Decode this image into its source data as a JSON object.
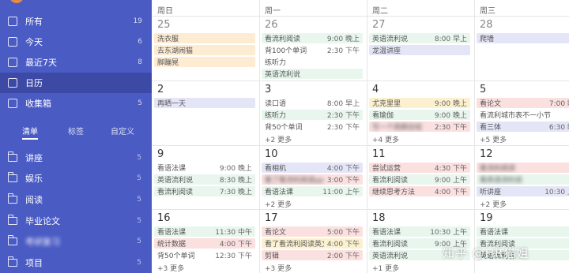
{
  "sidebar": {
    "items": [
      {
        "label": "所有",
        "count": "19"
      },
      {
        "label": "今天",
        "count": "6"
      },
      {
        "label": "最近7天",
        "count": "8"
      },
      {
        "label": "日历",
        "count": ""
      },
      {
        "label": "收集箱",
        "count": "5"
      }
    ],
    "tabs": [
      "清单",
      "标签",
      "自定义"
    ],
    "lists": [
      {
        "label": "讲座",
        "count": "5"
      },
      {
        "label": "娱乐",
        "count": "5"
      },
      {
        "label": "阅读",
        "count": "5"
      },
      {
        "label": "毕业论文",
        "count": "5"
      },
      {
        "label": "考研复习",
        "count": "5"
      },
      {
        "label": "项目",
        "count": "5"
      }
    ]
  },
  "calendar": {
    "headers": [
      "周日",
      "周一",
      "周二",
      "周三"
    ],
    "weeks": [
      {
        "days": [
          {
            "num": "25",
            "events": [
              {
                "title": "洗衣服",
                "time": "",
                "color": "orange"
              },
              {
                "title": "去东湖闹猫",
                "time": "",
                "color": "orange"
              },
              {
                "title": "脚蹦晃",
                "time": "",
                "color": "orange"
              }
            ],
            "more": ""
          },
          {
            "num": "26",
            "events": [
              {
                "title": "看流利阅读",
                "time": "9:00 晚上",
                "color": "green"
              },
              {
                "title": "背100个单词",
                "time": "2:30 下午",
                "color": "white"
              },
              {
                "title": "练听力",
                "time": "",
                "color": "white"
              },
              {
                "title": "英语流利说",
                "time": "",
                "color": "green"
              }
            ],
            "more": ""
          },
          {
            "num": "27",
            "events": [
              {
                "title": "英语流利说",
                "time": "8:00 早上",
                "color": "green"
              },
              {
                "title": "龙温讲座",
                "time": "",
                "color": "purple"
              }
            ],
            "more": ""
          },
          {
            "num": "28",
            "events": [
              {
                "title": "爬墙",
                "time": "",
                "color": "purple"
              }
            ],
            "more": ""
          }
        ]
      },
      {
        "days": [
          {
            "num": "2",
            "events": [
              {
                "title": "再晒一天",
                "time": "",
                "color": "purple"
              }
            ],
            "more": ""
          },
          {
            "num": "3",
            "events": [
              {
                "title": "读口语",
                "time": "8:00 早上",
                "color": "white"
              },
              {
                "title": "练听力",
                "time": "2:30 下午",
                "color": "green"
              },
              {
                "title": "背50个单词",
                "time": "2:30 下午",
                "color": "white"
              }
            ],
            "more": "+2 更多"
          },
          {
            "num": "4",
            "events": [
              {
                "title": "尤克里里",
                "time": "9:00 晚上",
                "color": "yellow"
              },
              {
                "title": "看瑜伽",
                "time": "9:00 晚上",
                "color": "green"
              },
              {
                "title": "写一个周期总结",
                "time": "2:30 下午",
                "color": "pink"
              }
            ],
            "more": "+4 更多"
          },
          {
            "num": "5",
            "events": [
              {
                "title": "看论文",
                "time": "7:00 晚",
                "color": "pink"
              },
              {
                "title": "看流利城市表不一小节",
                "time": "",
                "color": "white"
              },
              {
                "title": "看三体",
                "time": "6:30 晚",
                "color": "purple"
              }
            ],
            "more": "+5 更多"
          }
        ]
      },
      {
        "days": [
          {
            "num": "9",
            "events": [
              {
                "title": "看语法课",
                "time": "9:00 晚上",
                "color": "white"
              },
              {
                "title": "英语流利说",
                "time": "8:30 晚上",
                "color": "green"
              },
              {
                "title": "看流利阅读",
                "time": "7:30 晚上",
                "color": "green"
              }
            ],
            "more": ""
          },
          {
            "num": "10",
            "events": [
              {
                "title": "看相机",
                "time": "4:00 下午",
                "color": "purple"
              },
              {
                "title": "看了看流利阅读ppt",
                "time": "3:00 下午",
                "color": "pink"
              },
              {
                "title": "看语法课",
                "time": "11:00 上午",
                "color": "green"
              }
            ],
            "more": "+2 更多"
          },
          {
            "num": "11",
            "events": [
              {
                "title": "尝试运营",
                "time": "4:30 下午",
                "color": "pink"
              },
              {
                "title": "看流利阅读",
                "time": "9:00 上午",
                "color": "green"
              },
              {
                "title": "继续思考方法",
                "time": "4:00 下午",
                "color": "pink"
              }
            ],
            "more": ""
          },
          {
            "num": "12",
            "events": [
              {
                "title": "看流利阅读",
                "time": "",
                "color": "pink"
              },
              {
                "title": "看英语流利说",
                "time": "",
                "color": "green"
              },
              {
                "title": "听讲座",
                "time": "10:30 上",
                "color": "purple"
              }
            ],
            "more": "+2 更多"
          }
        ]
      },
      {
        "days": [
          {
            "num": "16",
            "events": [
              {
                "title": "看语法课",
                "time": "11:30 中午",
                "color": "green"
              },
              {
                "title": "统计数据",
                "time": "4:00 下午",
                "color": "pink"
              },
              {
                "title": "背50个单词",
                "time": "12:30 下午",
                "color": "white"
              }
            ],
            "more": "+3 更多"
          },
          {
            "num": "17",
            "events": [
              {
                "title": "看论文",
                "time": "5:00 下午",
                "color": "pink"
              },
              {
                "title": "看了看流利阅读英文",
                "time": "4:00 下午",
                "color": "yellow"
              },
              {
                "title": "剪辑",
                "time": "2:00 下午",
                "color": "pink"
              }
            ],
            "more": "+3 更多"
          },
          {
            "num": "18",
            "events": [
              {
                "title": "看语法课",
                "time": "10:30 上午",
                "color": "green"
              },
              {
                "title": "看流利阅读",
                "time": "9:00 上午",
                "color": "green"
              },
              {
                "title": "英语流利说",
                "time": "",
                "color": "green"
              }
            ],
            "more": "+1 更多"
          },
          {
            "num": "19",
            "events": [
              {
                "title": "看语法课",
                "time": "",
                "color": "green"
              },
              {
                "title": "看流利阅读",
                "time": "",
                "color": "green"
              },
              {
                "title": "英语流利说",
                "time": "",
                "color": "green"
              }
            ],
            "more": ""
          }
        ]
      }
    ]
  },
  "watermark": "知乎 @HR猫姐",
  "colors": {
    "sidebar_bg": "#4a5bc4",
    "sidebar_active": "#3c4aa6",
    "orange": "#fdebd2",
    "green": "#e8f6ee",
    "purple": "#e4e5f6",
    "pink": "#fbe0e0",
    "yellow": "#fcf1cf"
  }
}
